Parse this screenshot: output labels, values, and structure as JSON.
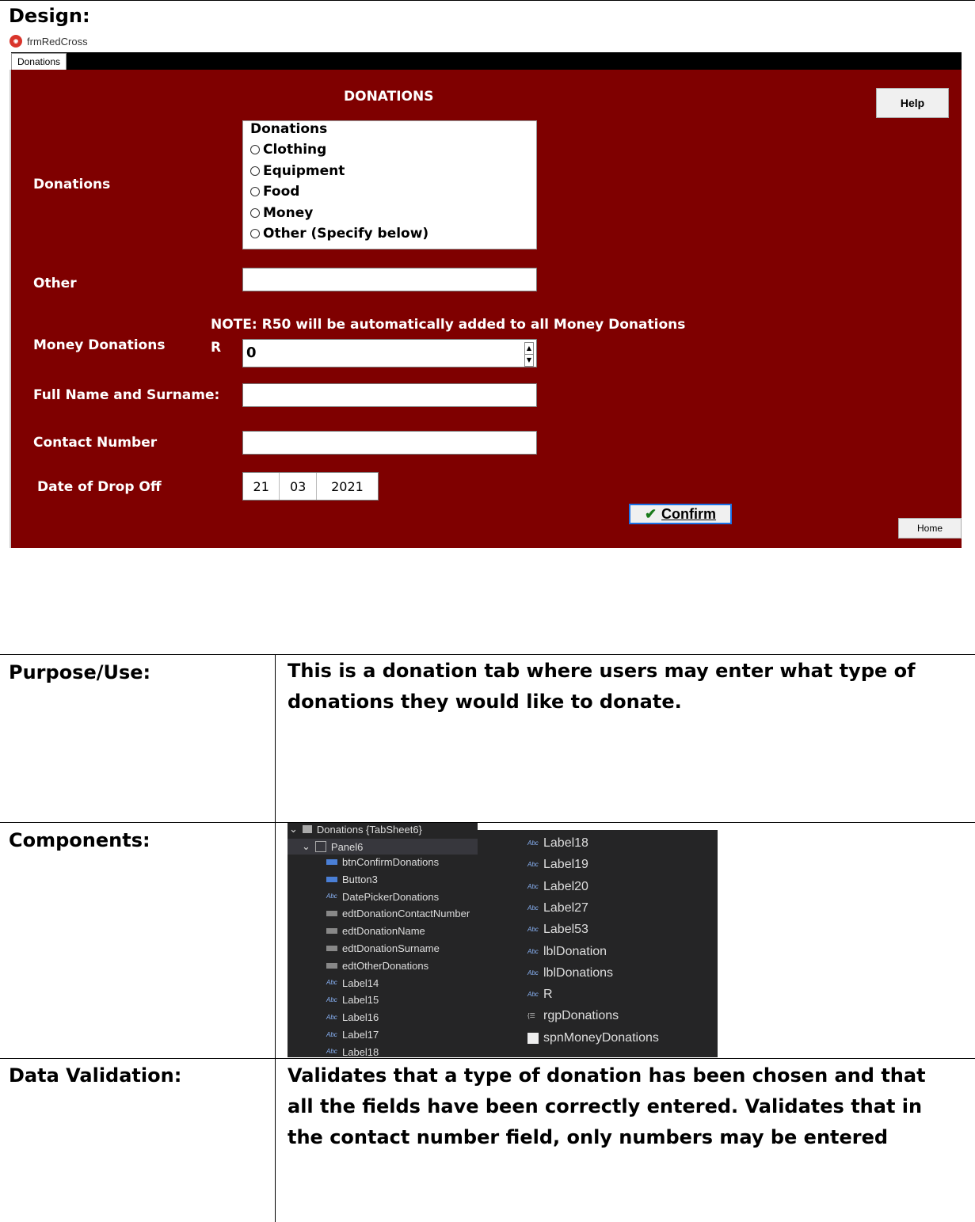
{
  "page": {
    "heading": "Design:"
  },
  "window": {
    "title": "frmRedCross",
    "tab_label": "Donations"
  },
  "form": {
    "title": "DONATIONS",
    "help_button": "Help",
    "donations_label": "Donations",
    "radio_group": {
      "caption": "Donations",
      "options": [
        "Clothing",
        "Equipment",
        "Food",
        "Money",
        "Other (Specify below)"
      ]
    },
    "other_label": "Other",
    "note": "NOTE: R50 will be automatically added to all Money Donations",
    "money_label": "Money Donations",
    "currency": "R",
    "money_value": "0",
    "name_label": "Full Name and Surname:",
    "contact_label": "Contact Number",
    "date_label": "Date of Drop Off",
    "date": {
      "day": "21",
      "month": "03",
      "year": "2021"
    },
    "confirm_button": "Confirm",
    "home_button": "Home"
  },
  "table": {
    "purpose_label": "Purpose/Use:",
    "purpose_text": "This is a donation tab where users may enter what type of donations they would like to donate.",
    "components_label": "Components:",
    "validation_label": "Data Validation:",
    "validation_text": "Validates that a type of donation has been chosen and that all the fields have been correctly entered. Validates that in the contact number field, only numbers may be entered"
  },
  "components_tree": {
    "root": "Donations {TabSheet6}",
    "panel": "Panel6",
    "left_items": [
      "btnConfirmDonations",
      "Button3",
      "DatePickerDonations",
      "edtDonationContactNumber",
      "edtDonationName",
      "edtDonationSurname",
      "edtOtherDonations",
      "Label14",
      "Label15",
      "Label16",
      "Label17",
      "Label18"
    ],
    "right_items": [
      "Label18",
      "Label19",
      "Label20",
      "Label27",
      "Label53",
      "lblDonation",
      "lblDonations",
      "R",
      "rgpDonations",
      "spnMoneyDonations"
    ]
  }
}
